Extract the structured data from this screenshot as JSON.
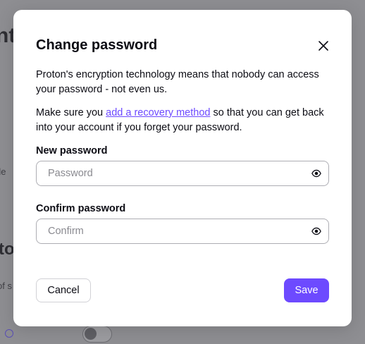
{
  "background": {
    "title_fragment": "nt",
    "title_fragment_2": "to",
    "label_fragment": "de",
    "label_fragment_2": "of s"
  },
  "modal": {
    "title": "Change password",
    "close_icon": "close-icon",
    "paragraph1": "Proton's encryption technology means that nobody can access your password - not even us.",
    "paragraph2_before": "Make sure you ",
    "paragraph2_link": "add a recovery method",
    "paragraph2_after": " so that you can get back into your account if you forget your password.",
    "new_password": {
      "label": "New password",
      "placeholder": "Password",
      "value": "",
      "icon": "eye-icon"
    },
    "confirm_password": {
      "label": "Confirm password",
      "placeholder": "Confirm",
      "value": "",
      "icon": "eye-icon"
    },
    "cancel_label": "Cancel",
    "save_label": "Save"
  },
  "colors": {
    "accent": "#6d4aff",
    "overlay": "#8e8e92",
    "text": "#0c0c14"
  }
}
